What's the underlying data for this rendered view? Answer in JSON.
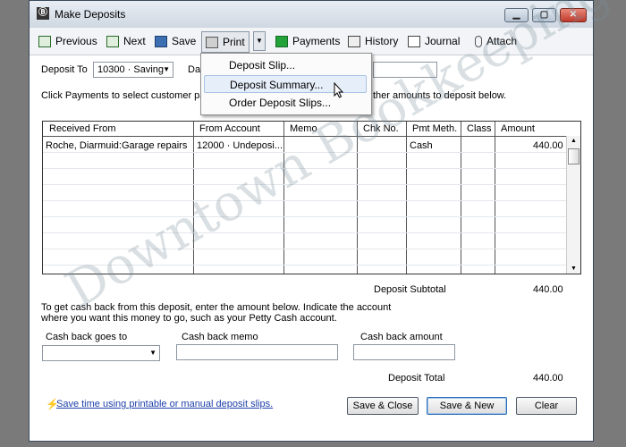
{
  "window": {
    "title": "Make Deposits"
  },
  "toolbar": {
    "previous": "Previous",
    "next": "Next",
    "save": "Save",
    "print": "Print",
    "payments": "Payments",
    "history": "History",
    "journal": "Journal",
    "attach": "Attach"
  },
  "print_menu": {
    "items": [
      "Deposit Slip...",
      "Deposit Summary...",
      "Order Deposit Slips..."
    ],
    "highlighted": "Deposit Summary..."
  },
  "form": {
    "deposit_to_label": "Deposit To",
    "deposit_to_value": "10300 · Saving",
    "date_label_partial": "Da",
    "instructions_left": "Click Payments to select customer pay",
    "instructions_right": "ther amounts to deposit below."
  },
  "grid": {
    "columns": [
      "Received From",
      "From Account",
      "Memo",
      "Chk No.",
      "Pmt Meth.",
      "Class",
      "Amount"
    ],
    "rows": [
      [
        "Roche, Diarmuid:Garage repairs",
        "12000 · Undeposi...",
        "",
        "",
        "Cash",
        "",
        "440.00"
      ]
    ]
  },
  "subtotal": {
    "label": "Deposit Subtotal",
    "value": "440.00"
  },
  "cashback": {
    "instructions_line1": "To get cash back from this deposit, enter the amount below.  Indicate the account",
    "instructions_line2": "where you want this money to go, such as your Petty Cash account.",
    "goes_to_label": "Cash back goes to",
    "memo_label": "Cash back memo",
    "amount_label": "Cash back amount"
  },
  "total": {
    "label": "Deposit Total",
    "value": "440.00"
  },
  "footer": {
    "link": "Save time using printable or manual deposit slips.",
    "save_close": "Save & Close",
    "save_new": "Save & New",
    "clear": "Clear"
  },
  "watermark": "Downtown Bookkeeping",
  "colors": {
    "link": "#1d3fa8",
    "highlight": "#e6eef9",
    "payments_icon": "#22a33a"
  }
}
